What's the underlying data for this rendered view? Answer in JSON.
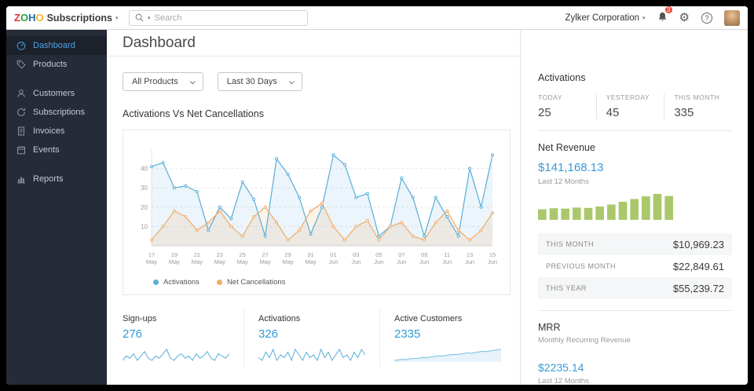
{
  "topbar": {
    "logo": {
      "letters": [
        {
          "ch": "Z",
          "color": "#e0342f"
        },
        {
          "ch": "O",
          "color": "#28a245"
        },
        {
          "ch": "H",
          "color": "#226db4"
        },
        {
          "ch": "O",
          "color": "#f4b21c"
        }
      ],
      "product": "Subscriptions"
    },
    "search_placeholder": "Search",
    "org_name": "Zylker Corporation",
    "notification_count": "3",
    "icons": [
      "search-icon",
      "bell-icon",
      "gear-icon",
      "help-icon",
      "user-avatar"
    ]
  },
  "sidebar": {
    "items": [
      {
        "label": "Dashboard",
        "icon": "dashboard-icon",
        "active": true
      },
      {
        "label": "Products",
        "icon": "tag-icon",
        "active": false
      },
      {
        "label": "Customers",
        "icon": "person-icon",
        "active": false
      },
      {
        "label": "Subscriptions",
        "icon": "refresh-icon",
        "active": false
      },
      {
        "label": "Invoices",
        "icon": "document-icon",
        "active": false
      },
      {
        "label": "Events",
        "icon": "calendar-icon",
        "active": false
      },
      {
        "label": "Reports",
        "icon": "bar-chart-icon",
        "active": false
      }
    ]
  },
  "main": {
    "title": "Dashboard",
    "filters": {
      "product": "All Products",
      "range": "Last 30 Days"
    },
    "chart_title": "Activations Vs Net Cancellations",
    "stats": [
      {
        "label": "Sign-ups",
        "value": "276"
      },
      {
        "label": "Activations",
        "value": "326"
      },
      {
        "label": "Active Customers",
        "value": "2335"
      }
    ]
  },
  "right_panel": {
    "activations": {
      "title": "Activations",
      "cols": [
        {
          "label": "TODAY",
          "value": "25"
        },
        {
          "label": "YESTERDAY",
          "value": "45"
        },
        {
          "label": "THIS MONTH",
          "value": "335"
        }
      ]
    },
    "net_revenue": {
      "title": "Net Revenue",
      "amount": "$141,168.13",
      "period": "Last 12 Months",
      "rows": [
        {
          "label": "THIS MONTH",
          "value": "$10,969.23"
        },
        {
          "label": "PREVIOUS MONTH",
          "value": "$22,849.61"
        },
        {
          "label": "THIS YEAR",
          "value": "$55,239.72"
        }
      ]
    },
    "mrr": {
      "title": "MRR",
      "subtitle": "Monthly Recurring Revenue",
      "amount": "$2235.14",
      "period": "Last 12 Months"
    }
  },
  "chart_data": [
    {
      "type": "line",
      "title": "Activations Vs Net Cancellations",
      "x_labels": [
        "17 May",
        "19 May",
        "21 May",
        "23 May",
        "25 May",
        "27 May",
        "29 May",
        "31 May",
        "01 Jun",
        "03 Jun",
        "05 Jun",
        "07 Jun",
        "09 Jun",
        "11 Jun",
        "13 Jun",
        "15 Jun"
      ],
      "ylim": [
        0,
        50
      ],
      "yticks": [
        10,
        20,
        30,
        40
      ],
      "grid": true,
      "legend_position": "bottom",
      "series": [
        {
          "name": "Activations",
          "color": "#58aed8",
          "fill": "rgba(100,175,220,0.12)",
          "values": [
            41,
            43,
            30,
            31,
            28,
            8,
            20,
            14,
            33,
            24,
            5,
            45,
            37,
            25,
            6,
            20,
            47,
            42,
            25,
            27,
            5,
            10,
            35,
            25,
            5,
            25,
            15,
            5,
            40,
            20,
            47
          ]
        },
        {
          "name": "Net Cancellations",
          "color": "#f0ab66",
          "fill": "rgba(240,170,100,0.15)",
          "values": [
            3,
            10,
            18,
            15,
            8,
            12,
            18,
            10,
            5,
            15,
            20,
            12,
            3,
            8,
            18,
            22,
            10,
            3,
            10,
            13,
            3,
            10,
            12,
            5,
            3,
            12,
            18,
            8,
            3,
            8,
            17
          ]
        }
      ]
    },
    {
      "type": "bar",
      "title": "Net Revenue - Last 12 Months",
      "color": "#a9c86b",
      "values": [
        31,
        34,
        33,
        36,
        35,
        39,
        45,
        53,
        61,
        69,
        76,
        70
      ]
    },
    {
      "type": "line",
      "title": "Sign-ups sparkline",
      "color": "#58aed8",
      "values": [
        4,
        6,
        5,
        7,
        4,
        6,
        8,
        5,
        4,
        6,
        5,
        7,
        9,
        5,
        4,
        6,
        7,
        5,
        6,
        4,
        7,
        5,
        6,
        8,
        5,
        4,
        7,
        6,
        5,
        7
      ]
    },
    {
      "type": "line",
      "title": "Activations sparkline",
      "color": "#58aed8",
      "values": [
        5,
        4,
        7,
        5,
        8,
        4,
        6,
        5,
        7,
        4,
        8,
        6,
        4,
        7,
        5,
        6,
        4,
        8,
        5,
        7,
        4,
        6,
        8,
        5,
        6,
        4,
        7,
        5,
        8,
        6
      ]
    },
    {
      "type": "area",
      "title": "Active Customers sparkline",
      "color": "#79bede",
      "fill": "rgba(120,185,225,0.18)",
      "values": [
        2,
        2.05,
        2.1,
        2.08,
        2.15,
        2.2,
        2.18,
        2.25,
        2.3,
        2.28,
        2.35,
        2.4,
        2.45,
        2.42,
        2.5,
        2.55,
        2.6,
        2.58,
        2.65,
        2.7,
        2.75,
        2.72,
        2.8,
        2.85,
        2.9,
        2.88,
        2.95,
        3.0,
        3.05,
        3.1
      ]
    }
  ]
}
